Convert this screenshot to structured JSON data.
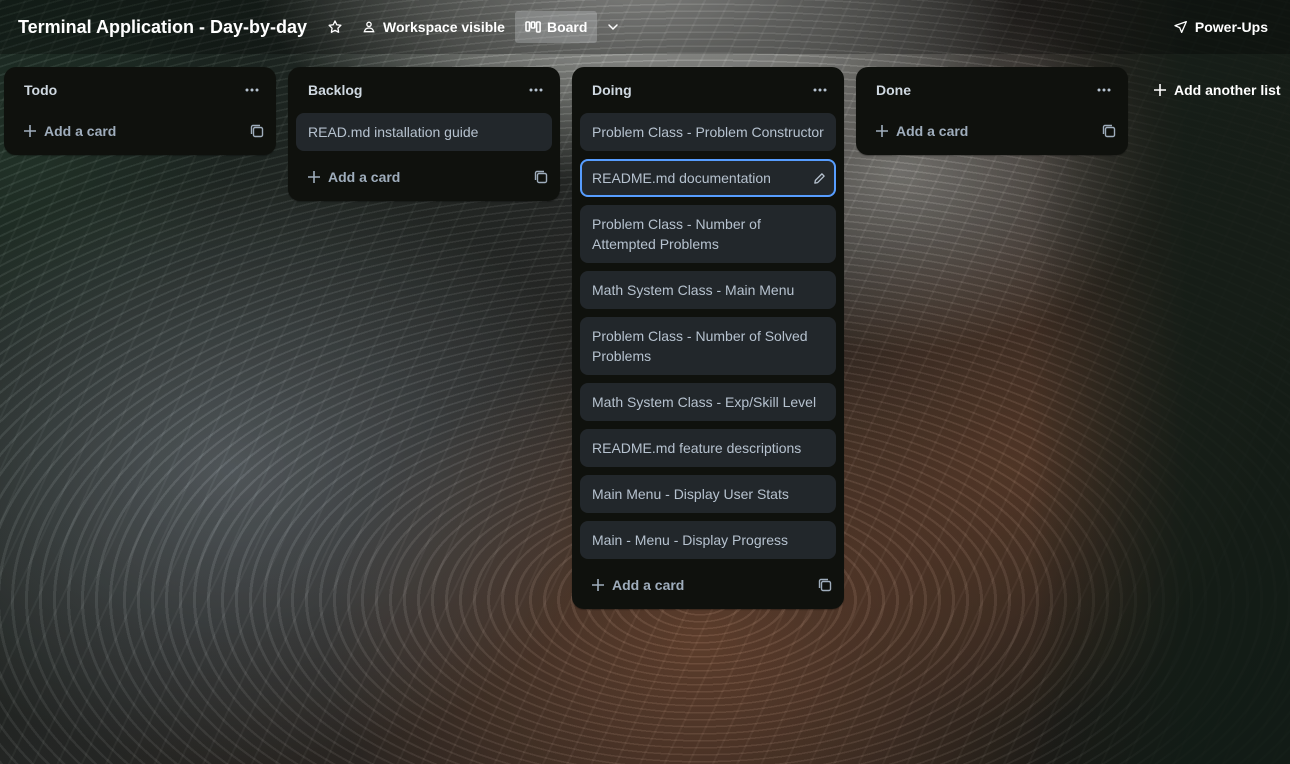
{
  "header": {
    "board_title": "Terminal Application - Day-by-day",
    "visibility_label": "Workspace visible",
    "view_label": "Board",
    "powerups_label": "Power-Ups"
  },
  "lists": [
    {
      "title": "Todo",
      "cards": [],
      "add_label": "Add a card"
    },
    {
      "title": "Backlog",
      "cards": [
        "READ.md installation guide"
      ],
      "add_label": "Add a card"
    },
    {
      "title": "Doing",
      "cards": [
        "Problem Class - Problem Constructor",
        "README.md documentation",
        "Problem Class - Number of Attempted Problems",
        "Math System Class - Main Menu",
        "Problem Class - Number of Solved Problems",
        "Math System Class - Exp/Skill Level",
        "README.md feature descriptions",
        "Main Menu - Display User Stats",
        "Main - Menu - Display Progress"
      ],
      "add_label": "Add a card"
    },
    {
      "title": "Done",
      "cards": [],
      "add_label": "Add a card"
    }
  ],
  "add_list_label": "Add another list",
  "colors": {
    "list_bg": "#0f110d",
    "card_bg": "#22272b",
    "focus_ring": "#579dff"
  }
}
